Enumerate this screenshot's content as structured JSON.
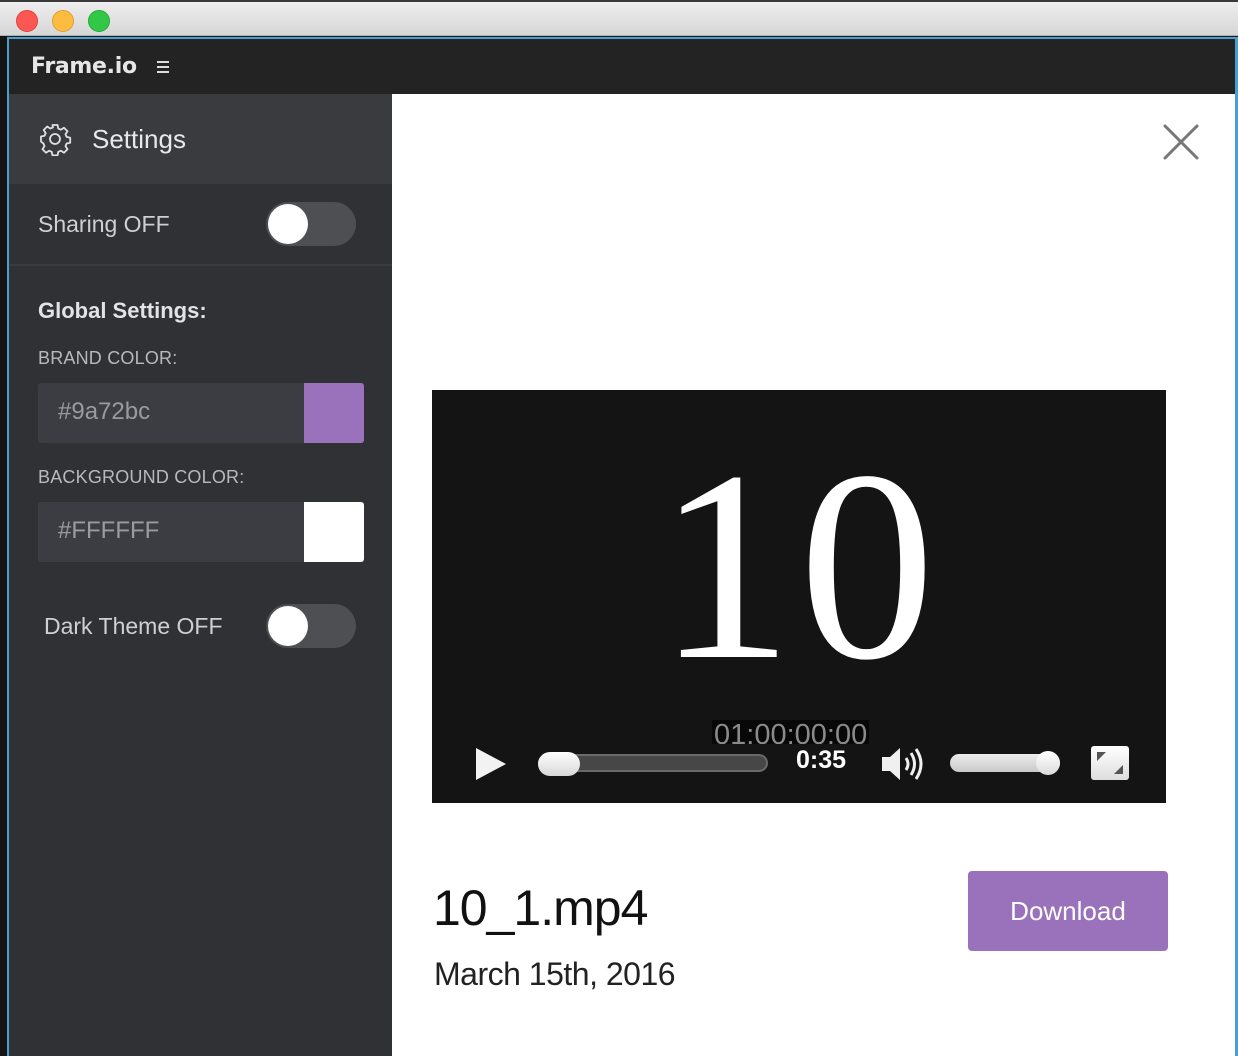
{
  "window": {
    "controls": [
      "close",
      "minimize",
      "zoom"
    ]
  },
  "header": {
    "brand": "Frame.io",
    "menu_icon": "hamburger-menu-icon"
  },
  "sidebar": {
    "title": "Settings",
    "title_icon": "gear-icon",
    "sharing": {
      "label": "Sharing OFF",
      "enabled": false
    },
    "global_settings": {
      "title": "Global Settings:",
      "brand_color": {
        "label": "BRAND COLOR:",
        "value": "#9a72bc",
        "swatch": "#9a72bc"
      },
      "background_color": {
        "label": "BACKGROUND COLOR:",
        "value": "#FFFFFF",
        "swatch": "#FFFFFF"
      }
    },
    "dark_theme": {
      "label": "Dark Theme OFF",
      "enabled": false
    }
  },
  "main": {
    "close_icon": "close-icon",
    "player": {
      "frame_text": "10",
      "timecode": "01:00:00:00",
      "current_time": "0:35",
      "progress": 0.0,
      "volume": 1.0
    },
    "file": {
      "name": "10_1.mp4",
      "date": "March 15th, 2016"
    },
    "download_label": "Download",
    "brand_color": "#9a72bc"
  }
}
